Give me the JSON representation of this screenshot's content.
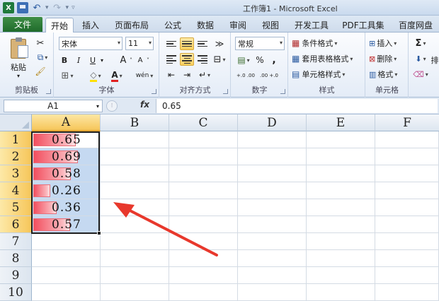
{
  "window": {
    "title": "工作簿1 - Microsoft Excel"
  },
  "tabs": [
    "文件",
    "开始",
    "插入",
    "页面布局",
    "公式",
    "数据",
    "审阅",
    "视图",
    "开发工具",
    "PDF工具集",
    "百度网盘"
  ],
  "ribbon": {
    "clipboard": {
      "paste_label": "粘贴",
      "group_label": "剪贴板"
    },
    "font": {
      "name": "宋体",
      "size": "11",
      "bold": "B",
      "italic": "I",
      "underline": "U",
      "grow": "A",
      "shrink": "A",
      "wen": "wén",
      "group_label": "字体"
    },
    "alignment": {
      "group_label": "对齐方式"
    },
    "number": {
      "format": "常规",
      "percent": "%",
      "comma": ",",
      "inc": "+.0 .00",
      "dec": ".00 +.0",
      "group_label": "数字"
    },
    "styles": {
      "conditional": "条件格式",
      "table": "套用表格格式",
      "cell_styles": "单元格样式",
      "group_label": "样式"
    },
    "cells": {
      "insert": "插入",
      "delete": "删除",
      "format": "格式",
      "group_label": "单元格"
    },
    "editing": {
      "sum": "Σ",
      "sort_label": "排"
    }
  },
  "formula_bar": {
    "name_box": "A1",
    "fx": "fx",
    "value": "0.65"
  },
  "sheet": {
    "columns": [
      "A",
      "B",
      "C",
      "D",
      "E",
      "F"
    ],
    "rows": [
      "1",
      "2",
      "3",
      "4",
      "5",
      "6",
      "7",
      "8",
      "9",
      "10"
    ],
    "values": [
      "0.65",
      "0.69",
      "0.58",
      "0.26",
      "0.36",
      "0.57"
    ],
    "data_bar_fraction": [
      0.65,
      0.69,
      0.58,
      0.26,
      0.36,
      0.57
    ]
  },
  "colors": {
    "data_bar": "#f25060",
    "selection": "#c5d9f1",
    "arrow": "#e8382c"
  }
}
